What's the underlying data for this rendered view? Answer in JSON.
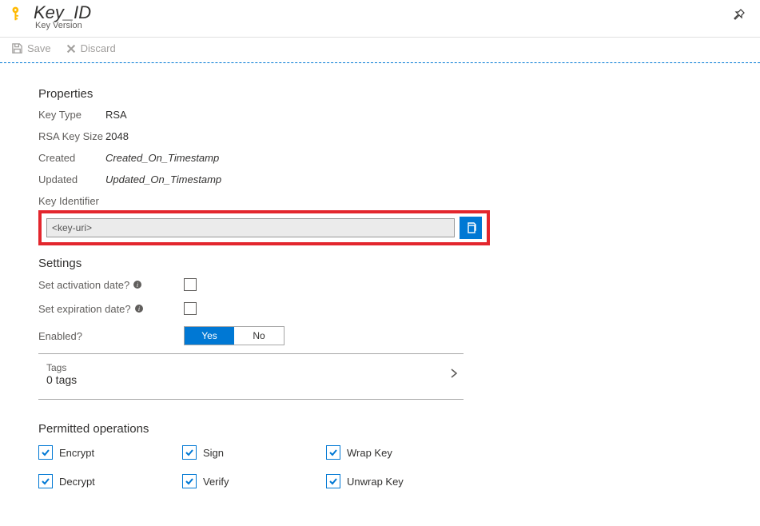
{
  "header": {
    "title": "Key_ID",
    "subtitle": "Key Version"
  },
  "toolbar": {
    "save": "Save",
    "discard": "Discard"
  },
  "properties": {
    "title": "Properties",
    "key_type_label": "Key Type",
    "key_type_value": "RSA",
    "rsa_size_label": "RSA Key Size",
    "rsa_size_value": "2048",
    "created_label": "Created",
    "created_value": "Created_On_Timestamp",
    "updated_label": "Updated",
    "updated_value": "Updated_On_Timestamp",
    "key_id_label": "Key Identifier",
    "key_uri": "<key-uri>"
  },
  "settings": {
    "title": "Settings",
    "activation_label": "Set activation date?",
    "activation_checked": false,
    "expiration_label": "Set expiration date?",
    "expiration_checked": false,
    "enabled_label": "Enabled?",
    "yes": "Yes",
    "no": "No",
    "enabled_value": "Yes"
  },
  "tags": {
    "label": "Tags",
    "count": "0 tags"
  },
  "operations": {
    "title": "Permitted operations",
    "items": [
      {
        "label": "Encrypt",
        "checked": true
      },
      {
        "label": "Sign",
        "checked": true
      },
      {
        "label": "Wrap Key",
        "checked": true
      },
      {
        "label": "Decrypt",
        "checked": true
      },
      {
        "label": "Verify",
        "checked": true
      },
      {
        "label": "Unwrap Key",
        "checked": true
      }
    ]
  }
}
